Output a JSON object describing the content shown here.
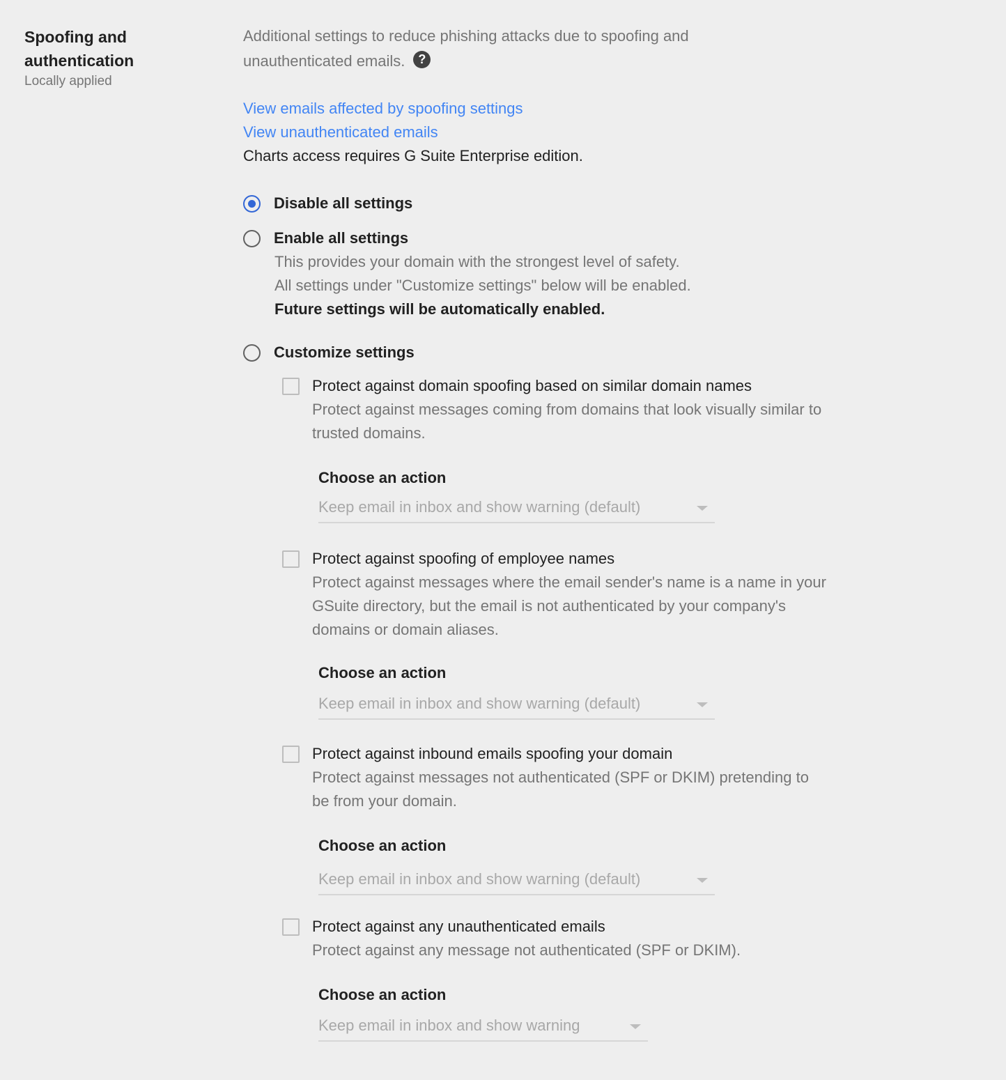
{
  "section": {
    "title": "Spoofing and authentication",
    "subtitle": "Locally applied"
  },
  "intro": {
    "text": "Additional settings to reduce phishing attacks due to spoofing and unauthenticated emails.",
    "help_icon": "question-mark-circle"
  },
  "links": {
    "spoofing": "View emails affected by spoofing settings",
    "unauthenticated": "View unauthenticated emails"
  },
  "note": "Charts access requires G Suite Enterprise edition.",
  "mode": {
    "disable": {
      "label": "Disable all settings",
      "selected": true
    },
    "enable": {
      "label": "Enable all settings",
      "selected": false,
      "desc1": "This provides your domain with the strongest level of safety.",
      "desc2": "All settings under \"Customize settings\" below will be enabled.",
      "desc3": "Future settings will be automatically enabled."
    },
    "customize": {
      "label": "Customize settings",
      "selected": false
    }
  },
  "options": [
    {
      "title": "Protect against domain spoofing based on similar domain names",
      "description": "Protect against messages coming from domains that look visually similar to trusted domains.",
      "checked": false,
      "action_label": "Choose an action",
      "action_value": "Keep email in inbox and show warning (default)"
    },
    {
      "title": "Protect against spoofing of employee names",
      "description": "Protect against messages where the email sender's name is a name in your GSuite directory, but the email is not authenticated by your company's domains or domain aliases.",
      "checked": false,
      "action_label": "Choose an action",
      "action_value": "Keep email in inbox and show warning (default)"
    },
    {
      "title": "Protect against inbound emails spoofing your domain",
      "description": "Protect against messages not authenticated (SPF or DKIM) pretending to be from your domain.",
      "checked": false,
      "action_label": "Choose an action",
      "action_value": "Keep email in inbox and show warning (default)"
    },
    {
      "title": "Protect against any unauthenticated emails",
      "description": "Protect against any message not authenticated (SPF or DKIM).",
      "checked": false,
      "action_label": "Choose an action",
      "action_value": "Keep email in inbox and show warning"
    }
  ],
  "colors": {
    "background": "#eeeeee",
    "link": "#4285f4",
    "radio_selected": "#3367d6",
    "muted_text": "#757575"
  }
}
